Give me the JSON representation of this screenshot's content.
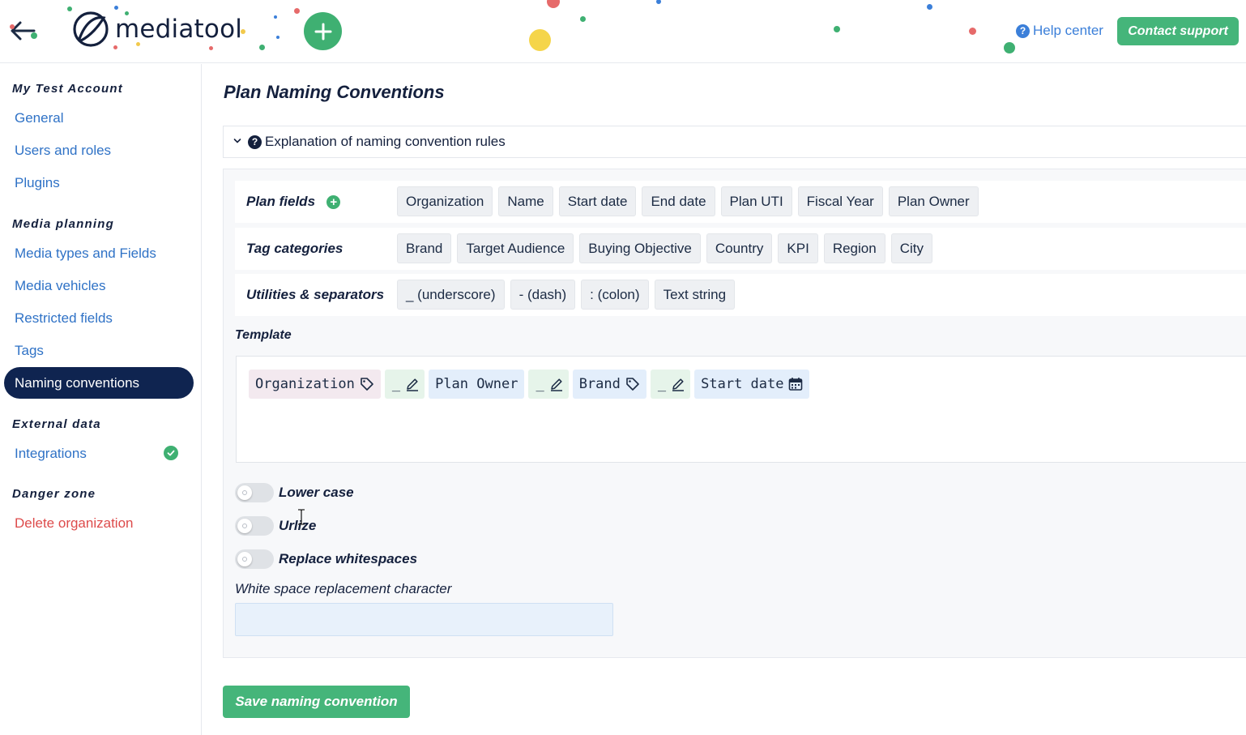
{
  "header": {
    "logo_text": "mediatool",
    "help_label": "Help center",
    "help_icon_glyph": "?",
    "contact_label": "Contact support",
    "accent": "#45b57a"
  },
  "sidebar": {
    "sections": [
      {
        "heading": "My Test Account",
        "items": [
          "General",
          "Users and roles",
          "Plugins"
        ]
      },
      {
        "heading": "Media planning",
        "items": [
          "Media types and Fields",
          "Media vehicles",
          "Restricted fields",
          "Tags",
          "Naming conventions"
        ]
      },
      {
        "heading": "External data",
        "items": [
          "Integrations"
        ]
      },
      {
        "heading": "Danger zone",
        "items": [
          "Delete organization"
        ]
      }
    ],
    "active_item": "Naming conventions",
    "active_color": "#0f2450",
    "danger_color": "#dd4b4b"
  },
  "main": {
    "title": "Plan Naming Conventions",
    "explanation": "Explanation of naming convention rules",
    "rows": [
      {
        "label": "Plan fields",
        "chips": [
          "Organization",
          "Name",
          "Start date",
          "End date",
          "Plan UTI",
          "Fiscal Year",
          "Plan Owner"
        ]
      },
      {
        "label": "Tag categories",
        "chips": [
          "Brand",
          "Target Audience",
          "Buying Objective",
          "Country",
          "KPI",
          "Region",
          "City"
        ]
      },
      {
        "label": "Utilities & separators",
        "chips": [
          "_ (underscore)",
          "- (dash)",
          ": (colon)",
          "Text string"
        ]
      }
    ],
    "template_label": "Template",
    "template_tokens": [
      {
        "text": "Organization",
        "icon": "tag-icon"
      },
      {
        "text": "_",
        "icon": "pencil-icon"
      },
      {
        "text": "Plan Owner",
        "icon": ""
      },
      {
        "text": "_",
        "icon": "pencil-icon"
      },
      {
        "text": "Brand",
        "icon": "tag-icon"
      },
      {
        "text": "_",
        "icon": "pencil-icon"
      },
      {
        "text": "Start date",
        "icon": "calendar-icon"
      }
    ],
    "toggles": [
      {
        "label": "Lower case",
        "on": false
      },
      {
        "label": "Urlize",
        "on": false
      },
      {
        "label": "Replace whitespaces",
        "on": false
      }
    ],
    "whitespace_label": "White space replacement character",
    "whitespace_value": "",
    "save_label": "Save naming convention"
  }
}
